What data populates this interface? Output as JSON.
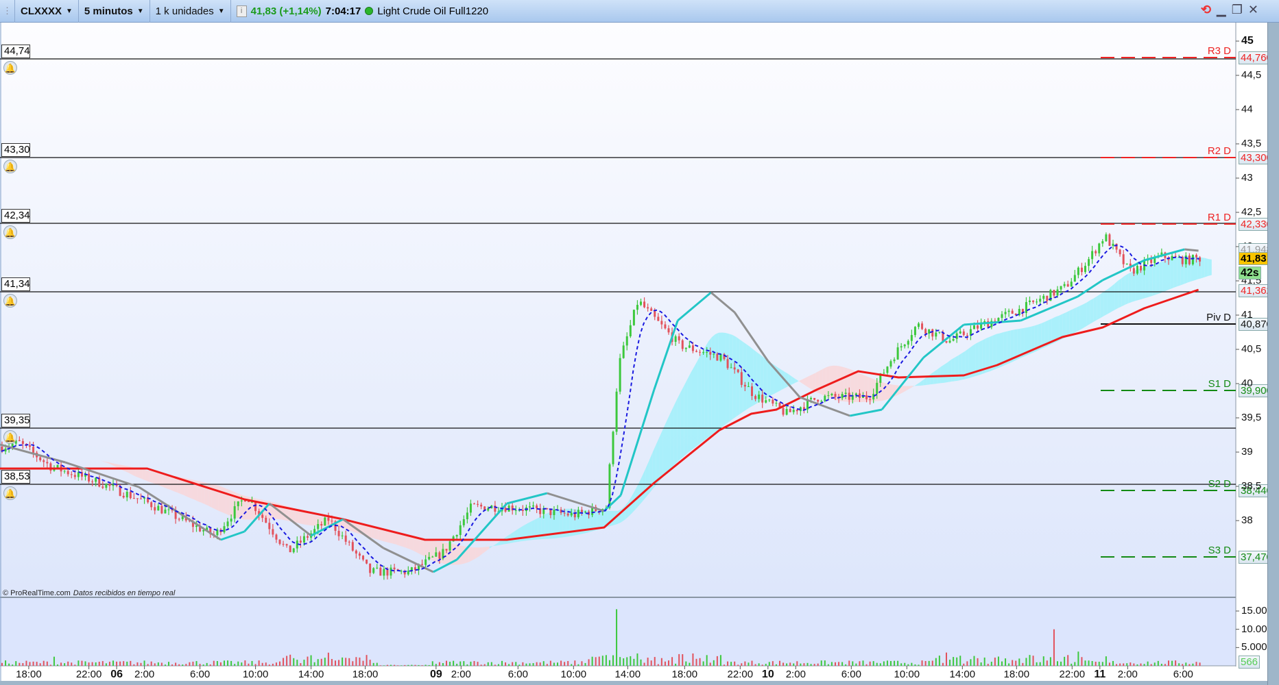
{
  "toolbar": {
    "symbol": "CLXXXX",
    "timeframe": "5 minutos",
    "units": "1 k unidades",
    "last_price": "41,83 (+1,14%)",
    "time": "7:04:17",
    "instrument": "Light Crude Oil Full1220"
  },
  "colors": {
    "up": "#3cc83c",
    "down": "#e2525c",
    "sma": "#ee1c1c",
    "kijun_up": "#22c6c6",
    "kijun_down": "#909090",
    "tenkan": "#1a1ae0",
    "cloud_bull": "#9ff0fa",
    "cloud_bear": "#f9d6d8",
    "support": "#138a13",
    "resistance": "#ee2222"
  },
  "alerts": [
    {
      "label": "44,74",
      "price": 44.74
    },
    {
      "label": "43,30",
      "price": 43.3
    },
    {
      "label": "42,34",
      "price": 42.34
    },
    {
      "label": "41,34",
      "price": 41.34
    },
    {
      "label": "39,35",
      "price": 39.35
    },
    {
      "label": "38,53",
      "price": 38.53
    }
  ],
  "pivots": [
    {
      "name": "R3 D",
      "value": "44,760",
      "price": 44.76,
      "kind": "r"
    },
    {
      "name": "R2 D",
      "value": "43,300",
      "price": 43.3,
      "kind": "r"
    },
    {
      "name": "R1 D",
      "value": "42,330",
      "price": 42.33,
      "kind": "r"
    },
    {
      "name": "Piv D",
      "value": "40,870",
      "price": 40.87,
      "kind": "p"
    },
    {
      "name": "S1 D",
      "value": "39,900",
      "price": 39.9,
      "kind": "s"
    },
    {
      "name": "S2 D",
      "value": "38,440",
      "price": 38.44,
      "kind": "s"
    },
    {
      "name": "S3 D",
      "value": "37,470",
      "price": 37.47,
      "kind": "s"
    }
  ],
  "right_labels": {
    "kijun": "41,948",
    "kijun_price": 41.948,
    "last": "41,83",
    "last_price": 41.83,
    "countdown": "42s",
    "sma": "41,362",
    "sma_price": 41.362
  },
  "price_ticks": [
    {
      "l": "45",
      "v": 45,
      "b": true
    },
    {
      "l": "44,5",
      "v": 44.5
    },
    {
      "l": "44",
      "v": 44
    },
    {
      "l": "43,5",
      "v": 43.5
    },
    {
      "l": "43",
      "v": 43
    },
    {
      "l": "42,5",
      "v": 42.5
    },
    {
      "l": "42",
      "v": 42
    },
    {
      "l": "41,5",
      "v": 41.5
    },
    {
      "l": "41",
      "v": 41
    },
    {
      "l": "40,5",
      "v": 40.5
    },
    {
      "l": "40",
      "v": 40
    },
    {
      "l": "39,5",
      "v": 39.5
    },
    {
      "l": "39",
      "v": 39
    },
    {
      "l": "38,5",
      "v": 38.5
    },
    {
      "l": "38",
      "v": 38
    }
  ],
  "volume_ticks": [
    {
      "l": "15.000",
      "v": 15000
    },
    {
      "l": "10.000",
      "v": 10000
    },
    {
      "l": "5.000",
      "v": 5000
    }
  ],
  "volume_last": "566",
  "time_ticks": [
    {
      "l": "18:00",
      "h": 2.07
    },
    {
      "l": "22:00",
      "h": 6.4
    },
    {
      "l": "06",
      "h": 8.4,
      "d": true
    },
    {
      "l": "2:00",
      "h": 10.4
    },
    {
      "l": "6:00",
      "h": 14.4
    },
    {
      "l": "10:00",
      "h": 18.4
    },
    {
      "l": "14:00",
      "h": 22.4
    },
    {
      "l": "18:00",
      "h": 26.3
    },
    {
      "l": "09",
      "h": 31.4,
      "d": true
    },
    {
      "l": "2:00",
      "h": 33.2
    },
    {
      "l": "6:00",
      "h": 37.3
    },
    {
      "l": "10:00",
      "h": 41.3
    },
    {
      "l": "14:00",
      "h": 45.2
    },
    {
      "l": "18:00",
      "h": 49.3
    },
    {
      "l": "22:00",
      "h": 53.3
    },
    {
      "l": "10",
      "h": 55.3,
      "d": true
    },
    {
      "l": "2:00",
      "h": 57.3
    },
    {
      "l": "6:00",
      "h": 61.3
    },
    {
      "l": "10:00",
      "h": 65.3
    },
    {
      "l": "14:00",
      "h": 69.3
    },
    {
      "l": "18:00",
      "h": 73.2
    },
    {
      "l": "22:00",
      "h": 77.2
    },
    {
      "l": "11",
      "h": 79.2,
      "d": true
    },
    {
      "l": "2:00",
      "h": 81.2
    },
    {
      "l": "6:00",
      "h": 85.2
    }
  ],
  "footer": {
    "copyright": "© ProRealTime.com",
    "status": "Datos recibidos en tiempo real"
  },
  "chart_data": {
    "type": "candlestick",
    "x_unit": "hours from left edge of chart",
    "ylim": [
      37.0,
      45.1
    ],
    "close_path": [
      [
        0,
        39.08
      ],
      [
        1.2,
        39.14
      ],
      [
        3.5,
        38.79
      ],
      [
        7.1,
        38.55
      ],
      [
        10.6,
        38.25
      ],
      [
        15.3,
        37.78
      ],
      [
        17.6,
        38.37
      ],
      [
        20.6,
        37.54
      ],
      [
        23.5,
        38.02
      ],
      [
        26.5,
        37.25
      ],
      [
        29.4,
        37.25
      ],
      [
        31.8,
        37.54
      ],
      [
        33.8,
        38.2
      ],
      [
        36.5,
        38.2
      ],
      [
        41.2,
        38.08
      ],
      [
        43.5,
        38.2
      ],
      [
        44.4,
        40.27
      ],
      [
        45.8,
        41.21
      ],
      [
        47.1,
        40.92
      ],
      [
        48.8,
        40.56
      ],
      [
        51.8,
        40.38
      ],
      [
        54.1,
        39.85
      ],
      [
        56.5,
        39.56
      ],
      [
        58.8,
        39.8
      ],
      [
        62.4,
        39.8
      ],
      [
        64.1,
        40.38
      ],
      [
        65.9,
        40.86
      ],
      [
        68.2,
        40.62
      ],
      [
        70.6,
        40.86
      ],
      [
        73.5,
        41.1
      ],
      [
        76.5,
        41.4
      ],
      [
        78.2,
        41.8
      ],
      [
        79.4,
        42.16
      ],
      [
        81.2,
        41.63
      ],
      [
        83.5,
        41.86
      ],
      [
        85.3,
        41.8
      ],
      [
        86.2,
        41.83
      ]
    ],
    "sma_path": [
      [
        0,
        38.76
      ],
      [
        10.6,
        38.76
      ],
      [
        17.6,
        38.31
      ],
      [
        24.7,
        38.02
      ],
      [
        30.6,
        37.72
      ],
      [
        36.5,
        37.72
      ],
      [
        43.5,
        37.9
      ],
      [
        47.1,
        38.55
      ],
      [
        51.8,
        39.32
      ],
      [
        54.1,
        39.56
      ],
      [
        55.9,
        39.62
      ],
      [
        58.8,
        39.91
      ],
      [
        61.8,
        40.18
      ],
      [
        64.7,
        40.09
      ],
      [
        69.4,
        40.12
      ],
      [
        71.8,
        40.27
      ],
      [
        76.5,
        40.68
      ],
      [
        79.4,
        40.82
      ],
      [
        82.4,
        41.1
      ],
      [
        86.3,
        41.37
      ]
    ],
    "kijun_path": [
      [
        0,
        39.11
      ],
      [
        4.7,
        38.85
      ],
      [
        10,
        38.49
      ],
      [
        15.9,
        37.72
      ],
      [
        17.6,
        37.84
      ],
      [
        19.4,
        38.25
      ],
      [
        22.4,
        37.78
      ],
      [
        24.7,
        38.02
      ],
      [
        27.6,
        37.6
      ],
      [
        31.2,
        37.25
      ],
      [
        32.9,
        37.43
      ],
      [
        36.5,
        38.25
      ],
      [
        39.4,
        38.4
      ],
      [
        43.5,
        38.14
      ],
      [
        44.7,
        38.37
      ],
      [
        47.1,
        39.91
      ],
      [
        48.8,
        40.92
      ],
      [
        51.2,
        41.33
      ],
      [
        52.9,
        41.04
      ],
      [
        55.3,
        40.33
      ],
      [
        57.6,
        39.8
      ],
      [
        61.2,
        39.53
      ],
      [
        63.5,
        39.62
      ],
      [
        66.5,
        40.38
      ],
      [
        69.4,
        40.86
      ],
      [
        73.5,
        40.92
      ],
      [
        77.6,
        41.27
      ],
      [
        79.4,
        41.51
      ],
      [
        82.4,
        41.8
      ],
      [
        85.3,
        41.96
      ],
      [
        86.3,
        41.94
      ]
    ],
    "volume_spikes": [
      [
        44.2,
        15500
      ],
      [
        75.7,
        10000
      ],
      [
        77.6,
        3900
      ],
      [
        79.4,
        2600
      ],
      [
        3.8,
        2500
      ],
      [
        23.4,
        3600
      ]
    ]
  }
}
